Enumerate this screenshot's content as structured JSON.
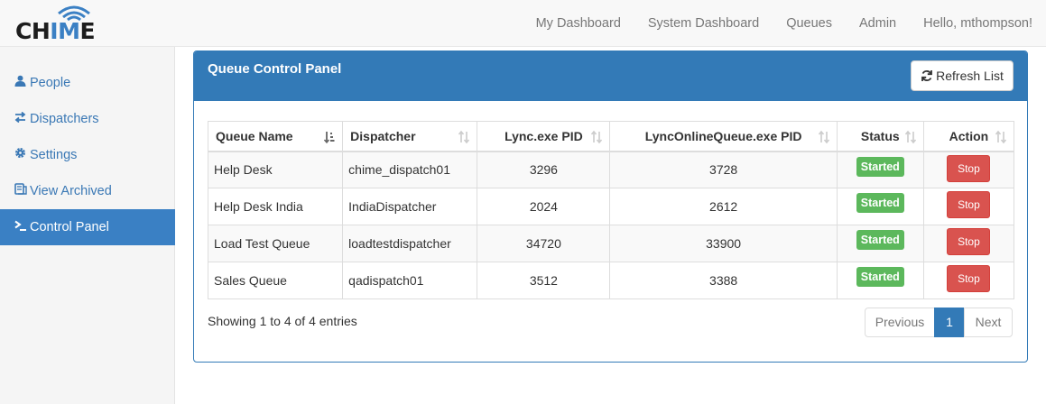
{
  "brand": {
    "logo_text_left": "CH",
    "logo_text_highlight": "IM",
    "logo_text_right": "E",
    "accent_color": "#3b80c4"
  },
  "nav": {
    "items": [
      "My Dashboard",
      "System Dashboard",
      "Queues",
      "Admin"
    ],
    "user_greeting": "Hello, mthompson!"
  },
  "sidebar": {
    "items": [
      {
        "label": "People",
        "icon": "user-icon"
      },
      {
        "label": "Dispatchers",
        "icon": "exchange-icon"
      },
      {
        "label": "Settings",
        "icon": "gear-icon"
      },
      {
        "label": "View Archived",
        "icon": "archive-icon"
      },
      {
        "label": "Control Panel",
        "icon": "terminal-icon",
        "active": true
      }
    ]
  },
  "panel": {
    "title": "Queue Control Panel",
    "refresh_label": "Refresh List"
  },
  "table": {
    "columns": [
      "Queue Name",
      "Dispatcher",
      "Lync.exe PID",
      "LyncOnlineQueue.exe PID",
      "Status",
      "Action"
    ],
    "rows": [
      {
        "queue": "Help Desk",
        "dispatcher": "chime_dispatch01",
        "lync_pid": "3296",
        "online_pid": "3728",
        "status": "Started",
        "action": "Stop"
      },
      {
        "queue": "Help Desk India",
        "dispatcher": "IndiaDispatcher",
        "lync_pid": "2024",
        "online_pid": "2612",
        "status": "Started",
        "action": "Stop"
      },
      {
        "queue": "Load Test Queue",
        "dispatcher": "loadtestdispatcher",
        "lync_pid": "34720",
        "online_pid": "33900",
        "status": "Started",
        "action": "Stop"
      },
      {
        "queue": "Sales Queue",
        "dispatcher": "qadispatch01",
        "lync_pid": "3512",
        "online_pid": "3388",
        "status": "Started",
        "action": "Stop"
      }
    ]
  },
  "footer": {
    "info": "Showing 1 to 4 of 4 entries",
    "prev": "Previous",
    "current_page": "1",
    "next": "Next"
  }
}
